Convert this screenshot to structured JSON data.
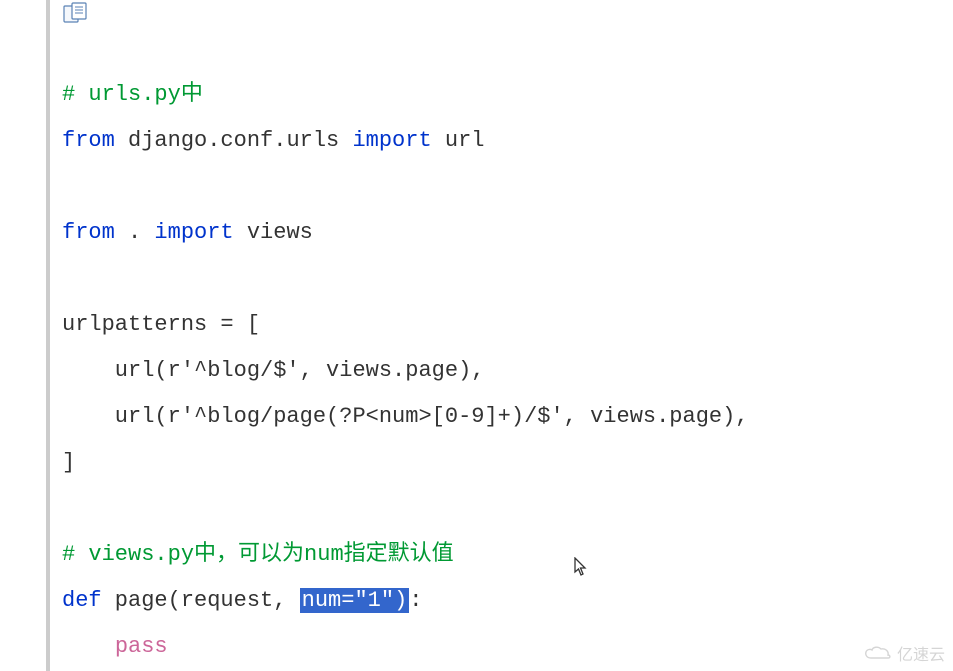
{
  "code": {
    "comment1_a": "# urls.py",
    "comment1_b": "中",
    "l2_from": "from",
    "l2_mid": " django.conf.urls ",
    "l2_import": "import",
    "l2_end": " url",
    "l3_from": "from",
    "l3_mid": " . ",
    "l3_import": "import",
    "l3_end": " views",
    "l4": "urlpatterns = [",
    "l5": "    url(r'^blog/$', views.page),",
    "l6": "    url(r'^blog/page(?P<num>[0-9]+)/$', views.page),",
    "l7": "]",
    "comment2_a": "# views.py",
    "comment2_b": "中，可以为",
    "comment2_c": "num",
    "comment2_d": "指定默认值",
    "l8_def": "def",
    "l8_mid": " page(request, ",
    "l8_hl": "num=\"1\")",
    "l8_end": ":",
    "l9_indent": "    ",
    "l9_pass": "pass"
  },
  "watermark": "亿速云"
}
